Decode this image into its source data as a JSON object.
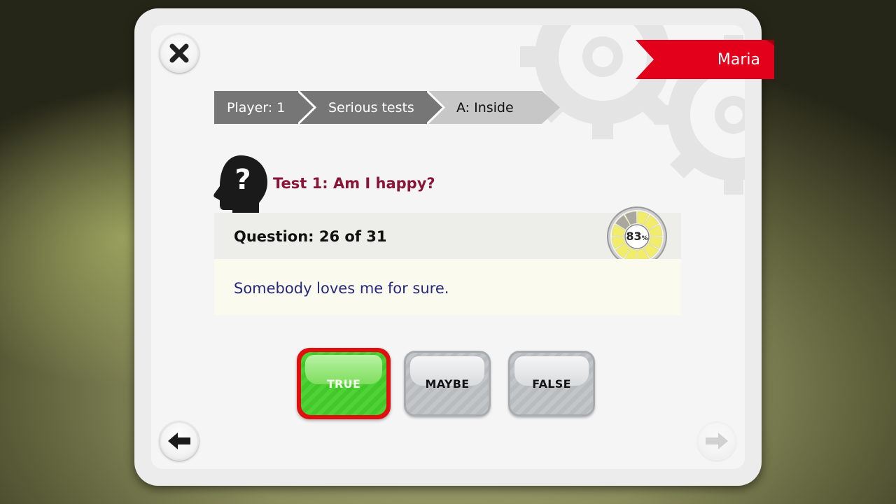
{
  "window": {
    "close_icon": "close-icon"
  },
  "player": {
    "name": "Maria",
    "banner_color": "#e2001a"
  },
  "breadcrumb": [
    {
      "label": "Player: 1"
    },
    {
      "label": "Serious tests"
    },
    {
      "label": "A: Inside"
    }
  ],
  "test": {
    "title": "Test 1: Am I happy?",
    "icon": "head-question-icon",
    "title_color": "#8a1538"
  },
  "question": {
    "counter": "Question: 26 of 31",
    "statement": "Somebody loves me for sure.",
    "statement_color": "#26287a"
  },
  "progress": {
    "value_text": "83",
    "unit": "%",
    "fraction": 0.83
  },
  "answers": [
    {
      "label": "TRUE",
      "selected": true,
      "color": "#4fd236"
    },
    {
      "label": "MAYBE",
      "selected": false
    },
    {
      "label": "FALSE",
      "selected": false
    }
  ],
  "navigation": {
    "back_icon": "arrow-left-icon",
    "next_icon": "arrow-right-icon",
    "next_enabled": false
  }
}
